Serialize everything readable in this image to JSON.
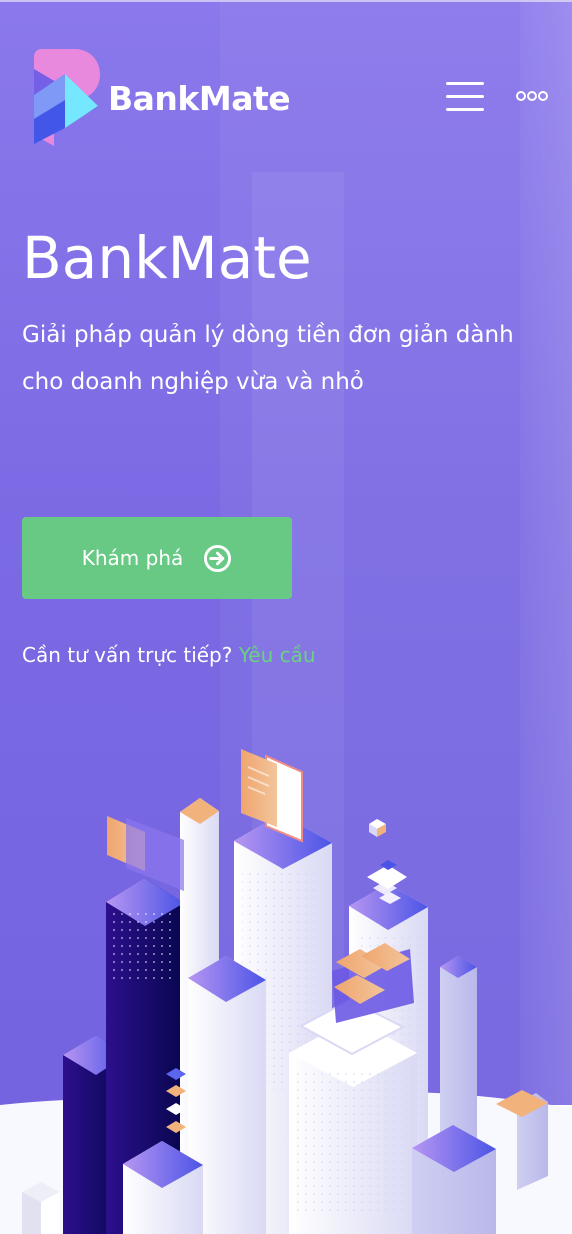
{
  "header": {
    "brand": "BankMate",
    "icons": {
      "logo": "bankmate-logo-mark",
      "menu": "hamburger-menu-icon",
      "more": "more-horizontal-icon"
    }
  },
  "hero": {
    "title": "BankMate",
    "description": "Giải pháp quản lý dòng tiền đơn giản dành cho doanh nghiệp vừa và nhỏ",
    "cta_label": "Khám phá",
    "cta_icon": "arrow-right-circle-icon",
    "consult_text": "Cần tư vấn trực tiếp?",
    "request_link": "Yêu cầu"
  },
  "colors": {
    "background": "#7b6ae3",
    "accent_green": "#68c985",
    "link_green": "#6bd083",
    "text": "#ffffff"
  },
  "illustration": {
    "name": "isometric-city-illustration"
  }
}
